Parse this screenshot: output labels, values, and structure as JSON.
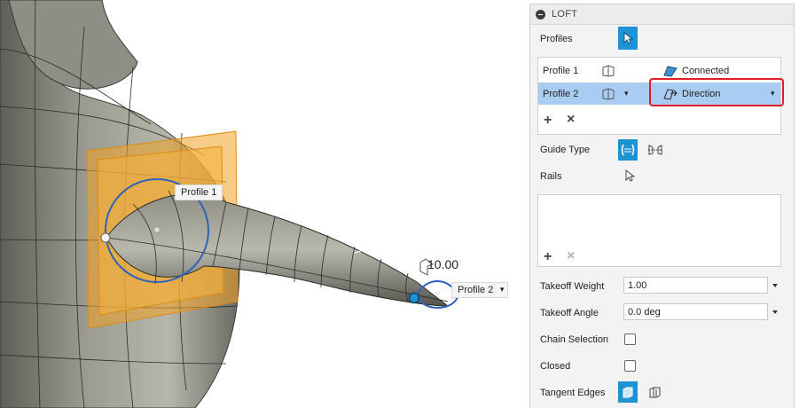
{
  "viewport": {
    "profile1_label": "Profile 1",
    "profile2_label": "Profile 2",
    "profile2_caret": "▾",
    "dimension_value": "10.00"
  },
  "panel": {
    "title": "LOFT",
    "profiles_label": "Profiles",
    "profile_rows": [
      {
        "name": "Profile 1",
        "condition": "Connected",
        "selected": false
      },
      {
        "name": "Profile 2",
        "condition": "Direction",
        "selected": true
      }
    ],
    "add_symbol": "+",
    "remove_symbol": "×",
    "caret": "▾",
    "guide_type_label": "Guide Type",
    "rails_label": "Rails",
    "takeoff_weight_label": "Takeoff Weight",
    "takeoff_weight_value": "1.00",
    "takeoff_angle_label": "Takeoff Angle",
    "takeoff_angle_value": "0.0 deg",
    "chain_selection_label": "Chain Selection",
    "chain_selection_checked": false,
    "closed_label": "Closed",
    "closed_checked": false,
    "tangent_edges_label": "Tangent Edges"
  },
  "colors": {
    "accent": "#1d93d2",
    "highlight_row": "#a9ccf2",
    "callout_red": "#e01e2a",
    "profile_plane": "#f0a322",
    "body_gray": "#7a7a72"
  },
  "icons": {
    "cursor": "select-arrow-icon",
    "connected": "connected-condition-icon",
    "direction": "direction-condition-icon",
    "guide_rails": "guide-rails-icon",
    "centerline": "centerline-icon",
    "tangent_merge": "tangent-merge-icon"
  }
}
